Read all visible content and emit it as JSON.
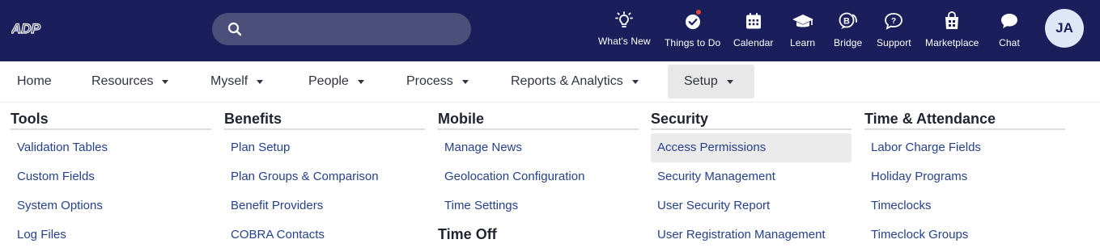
{
  "brand": {
    "logo_text": "ADP"
  },
  "search": {
    "placeholder": "",
    "value": ""
  },
  "top_actions": [
    {
      "label": "What's New",
      "icon": "lightbulb-icon"
    },
    {
      "label": "Things to Do",
      "icon": "check-circle-icon",
      "badge": true
    },
    {
      "label": "Calendar",
      "icon": "calendar-icon"
    },
    {
      "label": "Learn",
      "icon": "graduation-cap-icon"
    },
    {
      "label": "Bridge",
      "icon": "bridge-icon"
    },
    {
      "label": "Support",
      "icon": "support-chat-icon"
    },
    {
      "label": "Marketplace",
      "icon": "marketplace-bag-icon"
    },
    {
      "label": "Chat",
      "icon": "chat-bubble-icon"
    }
  ],
  "user": {
    "initials": "JA"
  },
  "nav": [
    {
      "label": "Home",
      "dropdown": false
    },
    {
      "label": "Resources",
      "dropdown": true
    },
    {
      "label": "Myself",
      "dropdown": true
    },
    {
      "label": "People",
      "dropdown": true
    },
    {
      "label": "Process",
      "dropdown": true
    },
    {
      "label": "Reports & Analytics",
      "dropdown": true
    },
    {
      "label": "Setup",
      "dropdown": true,
      "active": true
    }
  ],
  "menu": {
    "tools": {
      "heading": "Tools",
      "links": [
        "Validation Tables",
        "Custom Fields",
        "System Options",
        "Log Files"
      ]
    },
    "benefits": {
      "heading": "Benefits",
      "links": [
        "Plan Setup",
        "Plan Groups & Comparison",
        "Benefit Providers",
        "COBRA Contacts"
      ]
    },
    "mobile": {
      "heading": "Mobile",
      "links": [
        "Manage News",
        "Geolocation Configuration",
        "Time Settings"
      ]
    },
    "time_off": {
      "heading": "Time Off"
    },
    "security": {
      "heading": "Security",
      "links": [
        "Access Permissions",
        "Security Management",
        "User Security Report",
        "User Registration Management"
      ],
      "highlighted": "Access Permissions"
    },
    "time_attendance": {
      "heading": "Time & Attendance",
      "links": [
        "Labor Charge Fields",
        "Holiday Programs",
        "Timeclocks",
        "Timeclock Groups"
      ]
    }
  },
  "colors": {
    "topbar": "#1a1f5c",
    "link": "#24418c",
    "notification": "#e2463c"
  }
}
